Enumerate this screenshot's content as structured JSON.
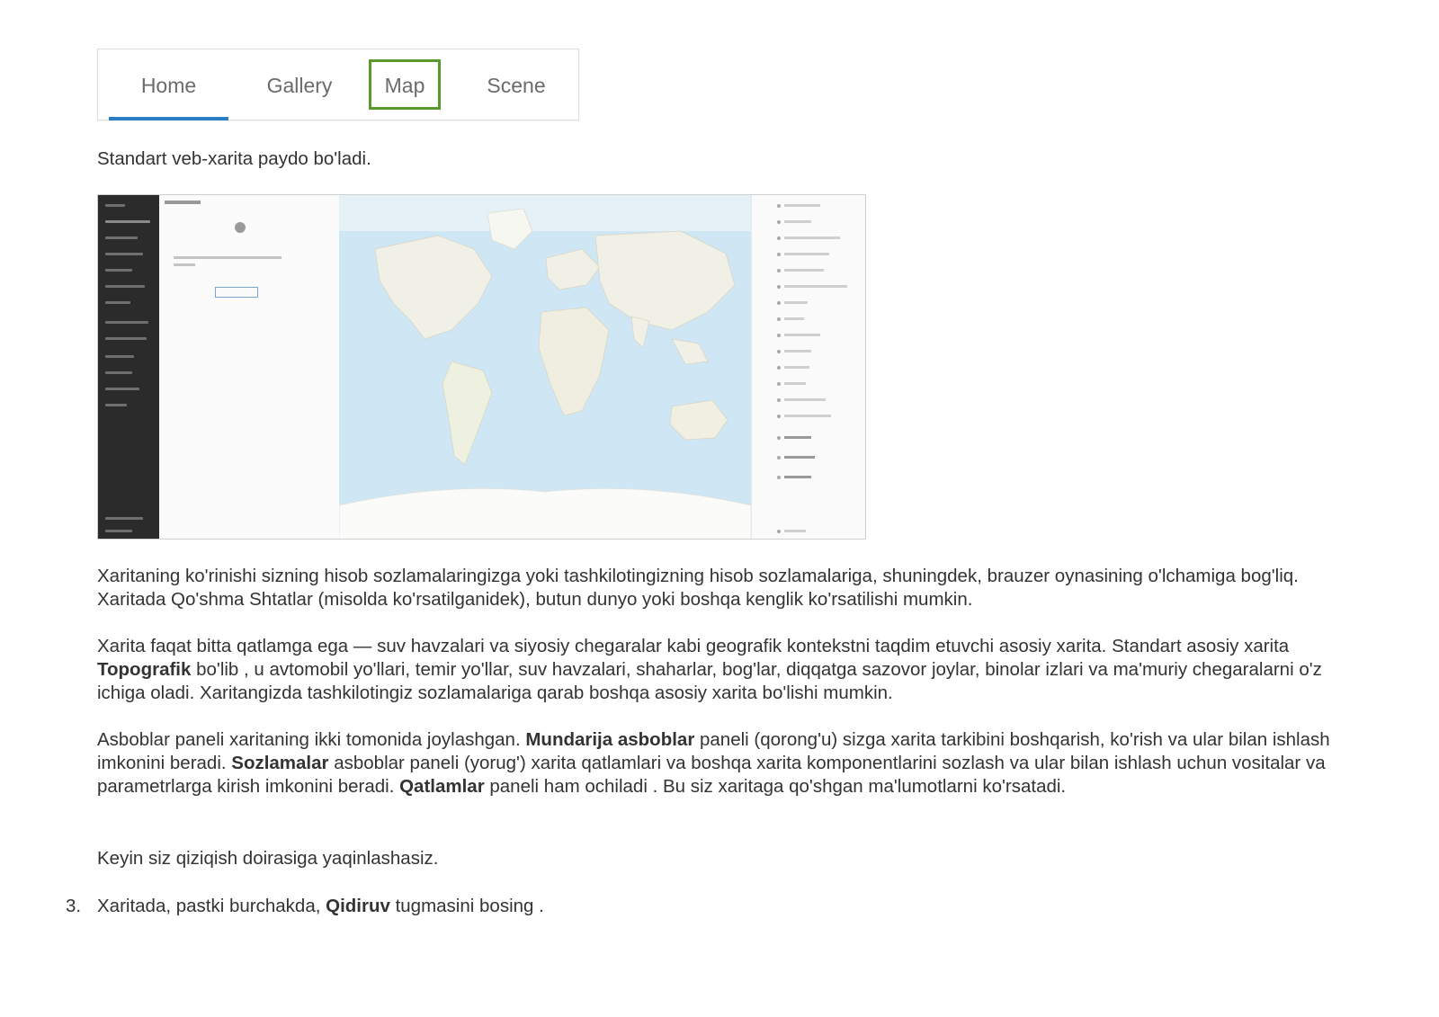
{
  "tabs": [
    {
      "label": "Home",
      "selected": true
    },
    {
      "label": "Gallery"
    },
    {
      "label": "Map",
      "highlighted": true
    },
    {
      "label": "Scene"
    }
  ],
  "paragraphs": {
    "p1": "Standart veb-xarita paydo bo'ladi.",
    "p2": "Xaritaning ko'rinishi sizning hisob sozlamalaringizga yoki tashkilotingizning hisob sozlamalariga, shuningdek, brauzer oynasining o'lchamiga bog'liq. Xaritada Qo'shma Shtatlar (misolda ko'rsatilganidek), butun dunyo yoki boshqa kenglik ko'rsatilishi mumkin.",
    "p3_a": "Xarita faqat bitta qatlamga ega — suv havzalari va siyosiy chegaralar kabi geografik kontekstni taqdim etuvchi asosiy xarita. Standart asosiy xarita ",
    "p3_b": "Topografik",
    "p3_c": " bo'lib , u avtomobil yo'llari, temir yo'llar, suv havzalari, shaharlar, bog'lar, diqqatga sazovor joylar, binolar izlari va ma'muriy chegaralarni o'z ichiga oladi. Xaritangizda tashkilotingiz sozlamalariga qarab boshqa asosiy xarita bo'lishi mumkin.",
    "p4_a": "Asboblar paneli xaritaning ikki tomonida joylashgan. ",
    "p4_b": "Mundarija asboblar",
    "p4_c": " paneli (qorong'u) sizga xarita tarkibini boshqarish, ko'rish va ular bilan ishlash imkonini beradi. ",
    "p4_d": "Sozlamalar",
    "p4_e": " asboblar paneli (yorug') xarita qatlamlari va boshqa xarita komponentlarini sozlash va ular bilan ishlash uchun vositalar va parametrlarga kirish imkonini beradi. ",
    "p4_f": "Qatlamlar",
    "p4_g": " paneli ham ochiladi . Bu siz xaritaga qo'shgan ma'lumotlarni ko'rsatadi.",
    "p5": "Keyin siz qiziqish doirasiga yaqinlashasiz."
  },
  "step": {
    "number": "3.",
    "text_a": "Xaritada, pastki burchakda, ",
    "text_b": "Qidiruv",
    "text_c": " tugmasini bosing ."
  },
  "colors": {
    "tab_underline": "#2a7ec4",
    "tab_highlight": "#5a9a2c",
    "ocean": "#cfe6f5",
    "land": "#f1f0e6"
  }
}
